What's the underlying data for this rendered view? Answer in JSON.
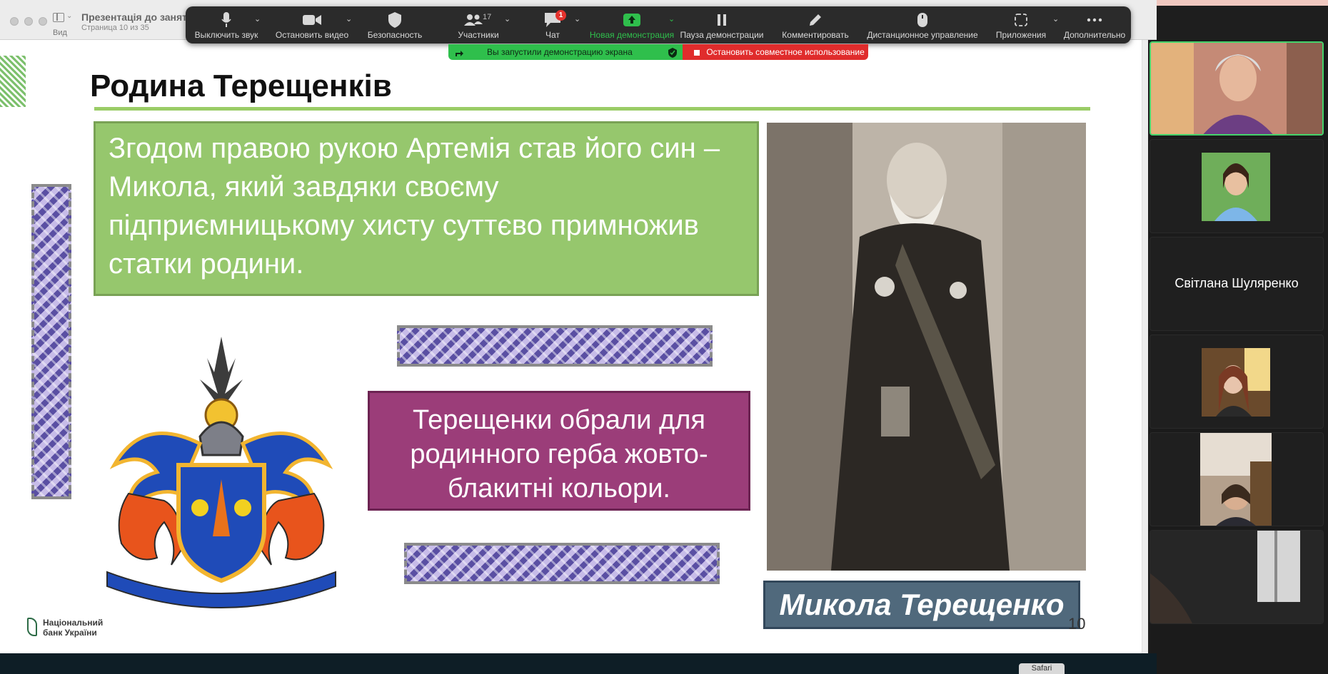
{
  "app": {
    "view_label": "Вид",
    "doc_title": "Презентація до занят",
    "doc_subtitle": "Страница 10 из 35"
  },
  "zoom_toolbar": {
    "items": [
      {
        "label": "Выключить звук",
        "icon": "microphone-icon"
      },
      {
        "label": "Остановить видео",
        "icon": "video-camera-icon"
      },
      {
        "label": "Безопасность",
        "icon": "shield-icon"
      },
      {
        "label": "Участники",
        "icon": "participants-icon",
        "count": "17"
      },
      {
        "label": "Чат",
        "icon": "chat-icon",
        "badge": "1"
      },
      {
        "label": "Новая демонстрация",
        "icon": "share-screen-icon"
      },
      {
        "label": "Пауза демонстрации",
        "icon": "pause-icon"
      },
      {
        "label": "Комментировать",
        "icon": "pen-icon"
      },
      {
        "label": "Дистанционное управление",
        "icon": "mouse-icon"
      },
      {
        "label": "Приложения",
        "icon": "apps-icon"
      },
      {
        "label": "Дополнительно",
        "icon": "more-icon"
      }
    ],
    "share_status": "Вы запустили демонстрацию экрана",
    "stop_share": "Остановить совместное использование",
    "colors": {
      "active_share": "#2fbf4c",
      "stop": "#e02c2c",
      "badge": "#e5322d"
    }
  },
  "slide": {
    "title": "Родина Терещенків",
    "green_text": "Згодом правою рукою Артемія став його син – Микола, який завдяки своєму підприємницькому хисту суттєво примножив статки родини.",
    "purple_text": "Терещенки обрали для родинного герба жовто-блакитні кольори.",
    "caption": "Микола Терещенко",
    "page_number": "10",
    "logo_line1": "Національний",
    "logo_line2": "банк України",
    "colors": {
      "green": "#96c76d",
      "purple": "#9b3d79",
      "caption": "#50697c",
      "rule": "#9acc66"
    }
  },
  "participants": {
    "tiles": [
      {
        "type": "video"
      },
      {
        "type": "video"
      },
      {
        "type": "name",
        "name": "Світлана Шуляренко"
      },
      {
        "type": "video"
      },
      {
        "type": "video"
      },
      {
        "type": "video"
      }
    ]
  },
  "dock": {
    "app_label": "Safari"
  }
}
